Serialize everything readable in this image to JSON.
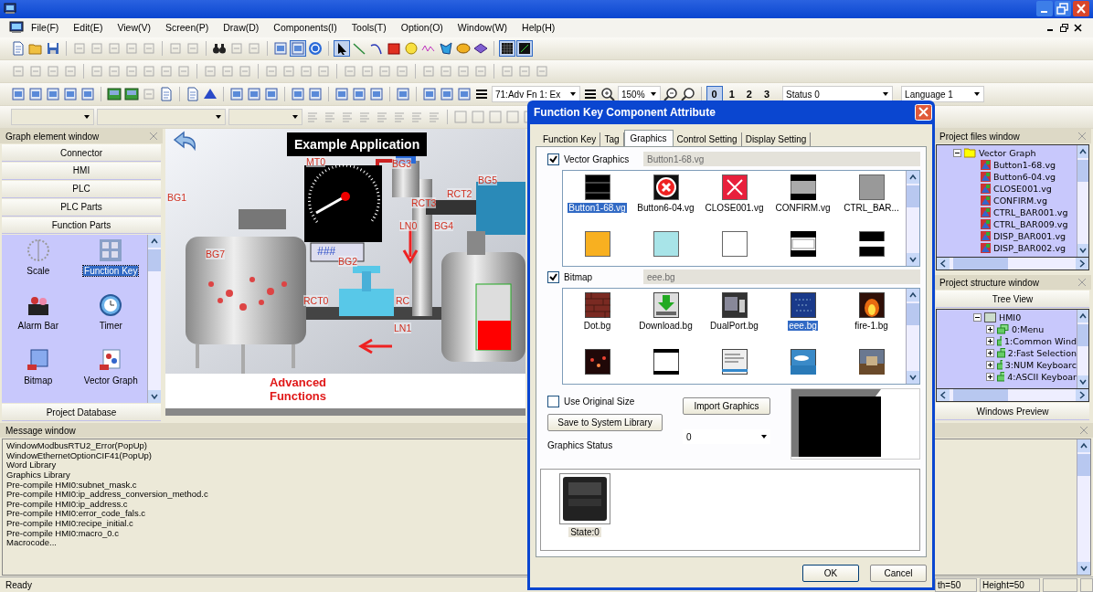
{
  "menu": [
    "File(F)",
    "Edit(E)",
    "View(V)",
    "Screen(P)",
    "Draw(D)",
    "Components(I)",
    "Tools(T)",
    "Option(O)",
    "Window(W)",
    "Help(H)"
  ],
  "toolbar": {
    "component_select": "71:Adv Fn 1: Ex",
    "zoom": "150%",
    "status_select": "Status 0",
    "language_select": "Language 1",
    "states": [
      {
        "label": "0",
        "selected": true
      },
      {
        "label": "1",
        "selected": false
      },
      {
        "label": "2",
        "selected": false
      },
      {
        "label": "3",
        "selected": false
      }
    ]
  },
  "graph_element_window": {
    "title": "Graph element window",
    "sections": [
      "Connector",
      "HMI",
      "PLC",
      "PLC Parts",
      "Function Parts"
    ],
    "items": [
      {
        "label": "Scale",
        "kind": "scale",
        "selected": false
      },
      {
        "label": "Function Key",
        "kind": "function-key",
        "selected": true
      },
      {
        "label": "Alarm Bar",
        "kind": "alarm",
        "selected": false
      },
      {
        "label": "Timer",
        "kind": "timer",
        "selected": false
      },
      {
        "label": "Bitmap",
        "kind": "bitmap",
        "selected": false
      },
      {
        "label": "Vector Graph",
        "kind": "vector",
        "selected": false
      }
    ],
    "footer_section": "Project Database"
  },
  "canvas": {
    "title": "Example Application",
    "labels": [
      "MT0",
      "BG3",
      "BG5",
      "RCT2",
      "BG1",
      "RCT3",
      "LN0",
      "BG4",
      "BG7",
      "BG2",
      "RCT0",
      "RC",
      "LN1"
    ],
    "display": "###",
    "footer": "Advanced Functions"
  },
  "dialog": {
    "title": "Function Key Component Attribute",
    "tabs": [
      {
        "label": "Function Key",
        "selected": false
      },
      {
        "label": "Tag",
        "selected": false
      },
      {
        "label": "Graphics",
        "selected": true
      },
      {
        "label": "Control Setting",
        "selected": false
      },
      {
        "label": "Display Setting",
        "selected": false
      }
    ],
    "vector_graphics": {
      "label": "Vector Graphics",
      "checked": true,
      "file": "Button1-68.vg",
      "items": [
        {
          "label": "Button1-68.vg",
          "kind": "black-bar",
          "selected": true
        },
        {
          "label": "Button6-04.vg",
          "kind": "error-circle",
          "selected": false
        },
        {
          "label": "CLOSE001.vg",
          "kind": "red-x",
          "selected": false
        },
        {
          "label": "CONFIRM.vg",
          "kind": "grey-band",
          "selected": false
        },
        {
          "label": "CTRL_BAR...",
          "kind": "grey-square",
          "selected": false
        },
        {
          "kind": "orange-square",
          "selected": false
        },
        {
          "kind": "cyan-square",
          "selected": false
        },
        {
          "kind": "white-square",
          "selected": false
        },
        {
          "kind": "white-band",
          "selected": false
        },
        {
          "kind": "white-stripe",
          "selected": false
        }
      ]
    },
    "bitmap": {
      "label": "Bitmap",
      "checked": true,
      "file": "eee.bg",
      "items": [
        {
          "label": "Dot.bg",
          "kind": "brick",
          "selected": false
        },
        {
          "label": "Download.bg",
          "kind": "download",
          "selected": false
        },
        {
          "label": "DualPort.bg",
          "kind": "device",
          "selected": false
        },
        {
          "label": "eee.bg",
          "kind": "circuit",
          "selected": true
        },
        {
          "label": "fire-1.bg",
          "kind": "fire",
          "selected": false
        },
        {
          "kind": "sparks",
          "selected": false
        },
        {
          "kind": "white-panel",
          "selected": false
        },
        {
          "kind": "text-panel",
          "selected": false
        },
        {
          "kind": "sky",
          "selected": false
        },
        {
          "kind": "castle",
          "selected": false
        }
      ]
    },
    "use_original_size": {
      "label": "Use Original Size",
      "checked": false
    },
    "save_button": "Save to System Library",
    "import_button": "Import Graphics",
    "status_select": "0",
    "status_label": "Graphics Status",
    "states": [
      {
        "label": "State:0",
        "selected": true
      }
    ],
    "buttons": [
      "OK",
      "Cancel"
    ]
  },
  "project_files": {
    "title": "Project files window",
    "folder": {
      "label": "Vector Graph",
      "expanded": true,
      "children": [
        "Button1-68.vg",
        "Button6-04.vg",
        "CLOSE001.vg",
        "CONFIRM.vg",
        "CTRL_BAR001.vg",
        "CTRL_BAR009.vg",
        "DISP_BAR001.vg",
        "DISP_BAR002.vg"
      ]
    }
  },
  "project_structure": {
    "title": "Project structure window",
    "tree_button": "Tree View",
    "root": {
      "label": "HMI0",
      "expanded": true,
      "children": [
        {
          "label": "0:Menu",
          "expanded": false
        },
        {
          "label": "1:Common Wind",
          "expanded": false
        },
        {
          "label": "2:Fast Selection",
          "expanded": false
        },
        {
          "label": "3:NUM Keyboarc",
          "expanded": false
        },
        {
          "label": "4:ASCII Keyboar",
          "expanded": false
        }
      ]
    },
    "preview_button": "Windows Preview"
  },
  "message_window": {
    "title": "Message window",
    "lines": [
      "WindowModbusRTU2_Error(PopUp)",
      "WindowEthernetOptionCIF41(PopUp)",
      "Word Library",
      "Graphics Library",
      "Pre-compile HMI0:subnet_mask.c",
      "Pre-compile HMI0:ip_address_conversion_method.c",
      "Pre-compile HMI0:ip_address.c",
      "Pre-compile HMI0:error_code_fals.c",
      "Pre-compile HMI0:recipe_initial.c",
      "Pre-compile HMI0:macro_0.c",
      "Macrocode..."
    ]
  },
  "status_bar": {
    "message": "Ready",
    "width": "th=50",
    "height": "Height=50"
  }
}
